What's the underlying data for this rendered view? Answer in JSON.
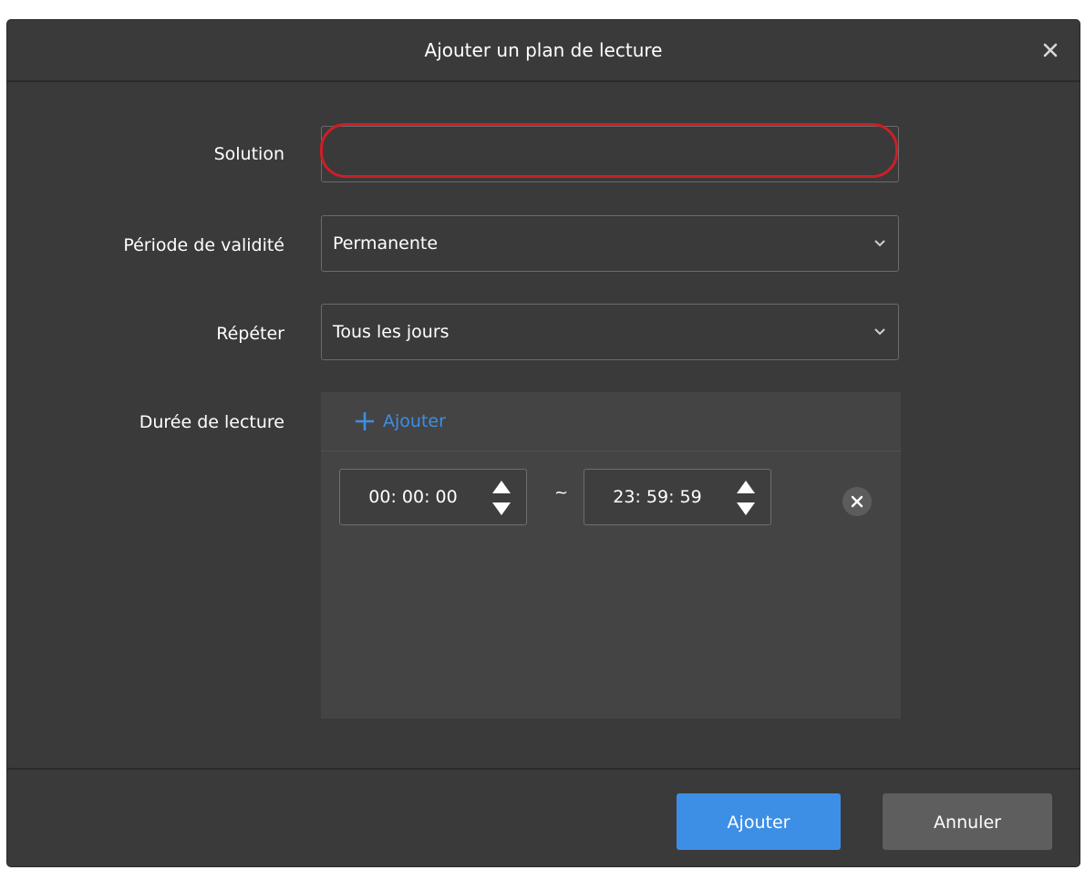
{
  "dialog": {
    "title": "Ajouter un plan de lecture"
  },
  "form": {
    "solution": {
      "label": "Solution",
      "value": ""
    },
    "validity": {
      "label": "Période de validité",
      "value": "Permanente"
    },
    "repeat": {
      "label": "Répéter",
      "value": "Tous les jours"
    },
    "duration": {
      "label": "Durée de lecture",
      "add_label": "Ajouter",
      "ranges": [
        {
          "start": "00: 00: 00",
          "separator": "~",
          "end": "23: 59: 59"
        }
      ]
    }
  },
  "footer": {
    "confirm_label": "Ajouter",
    "cancel_label": "Annuler"
  },
  "icons": {
    "close": "close-icon",
    "chevron": "chevron-down-icon",
    "add": "plus-icon",
    "spin": "spin-updown-icon",
    "remove": "remove-circle-icon"
  },
  "colors": {
    "dialog_bg": "#3a3a3a",
    "panel_bg": "#444444",
    "accent": "#3d8fe6",
    "highlight": "#cc1f26",
    "secondary_button": "#5e5e5e"
  }
}
